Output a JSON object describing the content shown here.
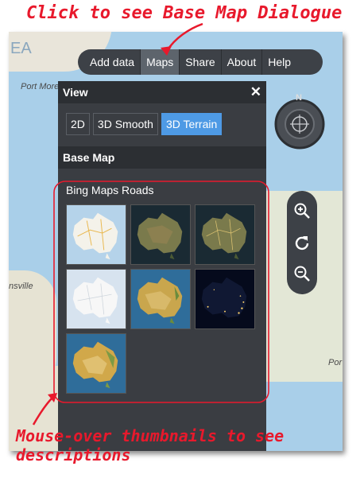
{
  "annotations": {
    "top": "Click to see Base Map Dialogue",
    "bottom_line1": "Mouse-over thumbnails to see",
    "bottom_line2": "descriptions"
  },
  "map_labels": {
    "sea": "EA",
    "port_moresby": "Port Moresby",
    "townsville": "nsville",
    "port": "Por"
  },
  "menubar": {
    "items": [
      {
        "label": "Add data",
        "active": false
      },
      {
        "label": "Maps",
        "active": true
      },
      {
        "label": "Share",
        "active": false
      },
      {
        "label": "About",
        "active": false
      },
      {
        "label": "Help",
        "active": false
      }
    ]
  },
  "panel": {
    "title": "View",
    "close": "✕",
    "view_modes": [
      "2D",
      "3D Smooth",
      "3D Terrain"
    ],
    "active_view": "3D Terrain",
    "basemap_heading": "Base Map",
    "selected_basemap": "Bing Maps Roads",
    "thumbnails": [
      {
        "icon": "roads-map-thumbnail"
      },
      {
        "icon": "aerial-map-thumbnail"
      },
      {
        "icon": "aerial-labels-map-thumbnail"
      },
      {
        "icon": "light-map-thumbnail"
      },
      {
        "icon": "natural-earth-map-thumbnail"
      },
      {
        "icon": "night-lights-map-thumbnail"
      },
      {
        "icon": "terrain-map-thumbnail"
      }
    ]
  },
  "controls": {
    "compass_label": "N"
  },
  "colors": {
    "accent": "#e8192c",
    "active_button": "#4e9ae5",
    "panel_bg": "#3a3d42"
  }
}
